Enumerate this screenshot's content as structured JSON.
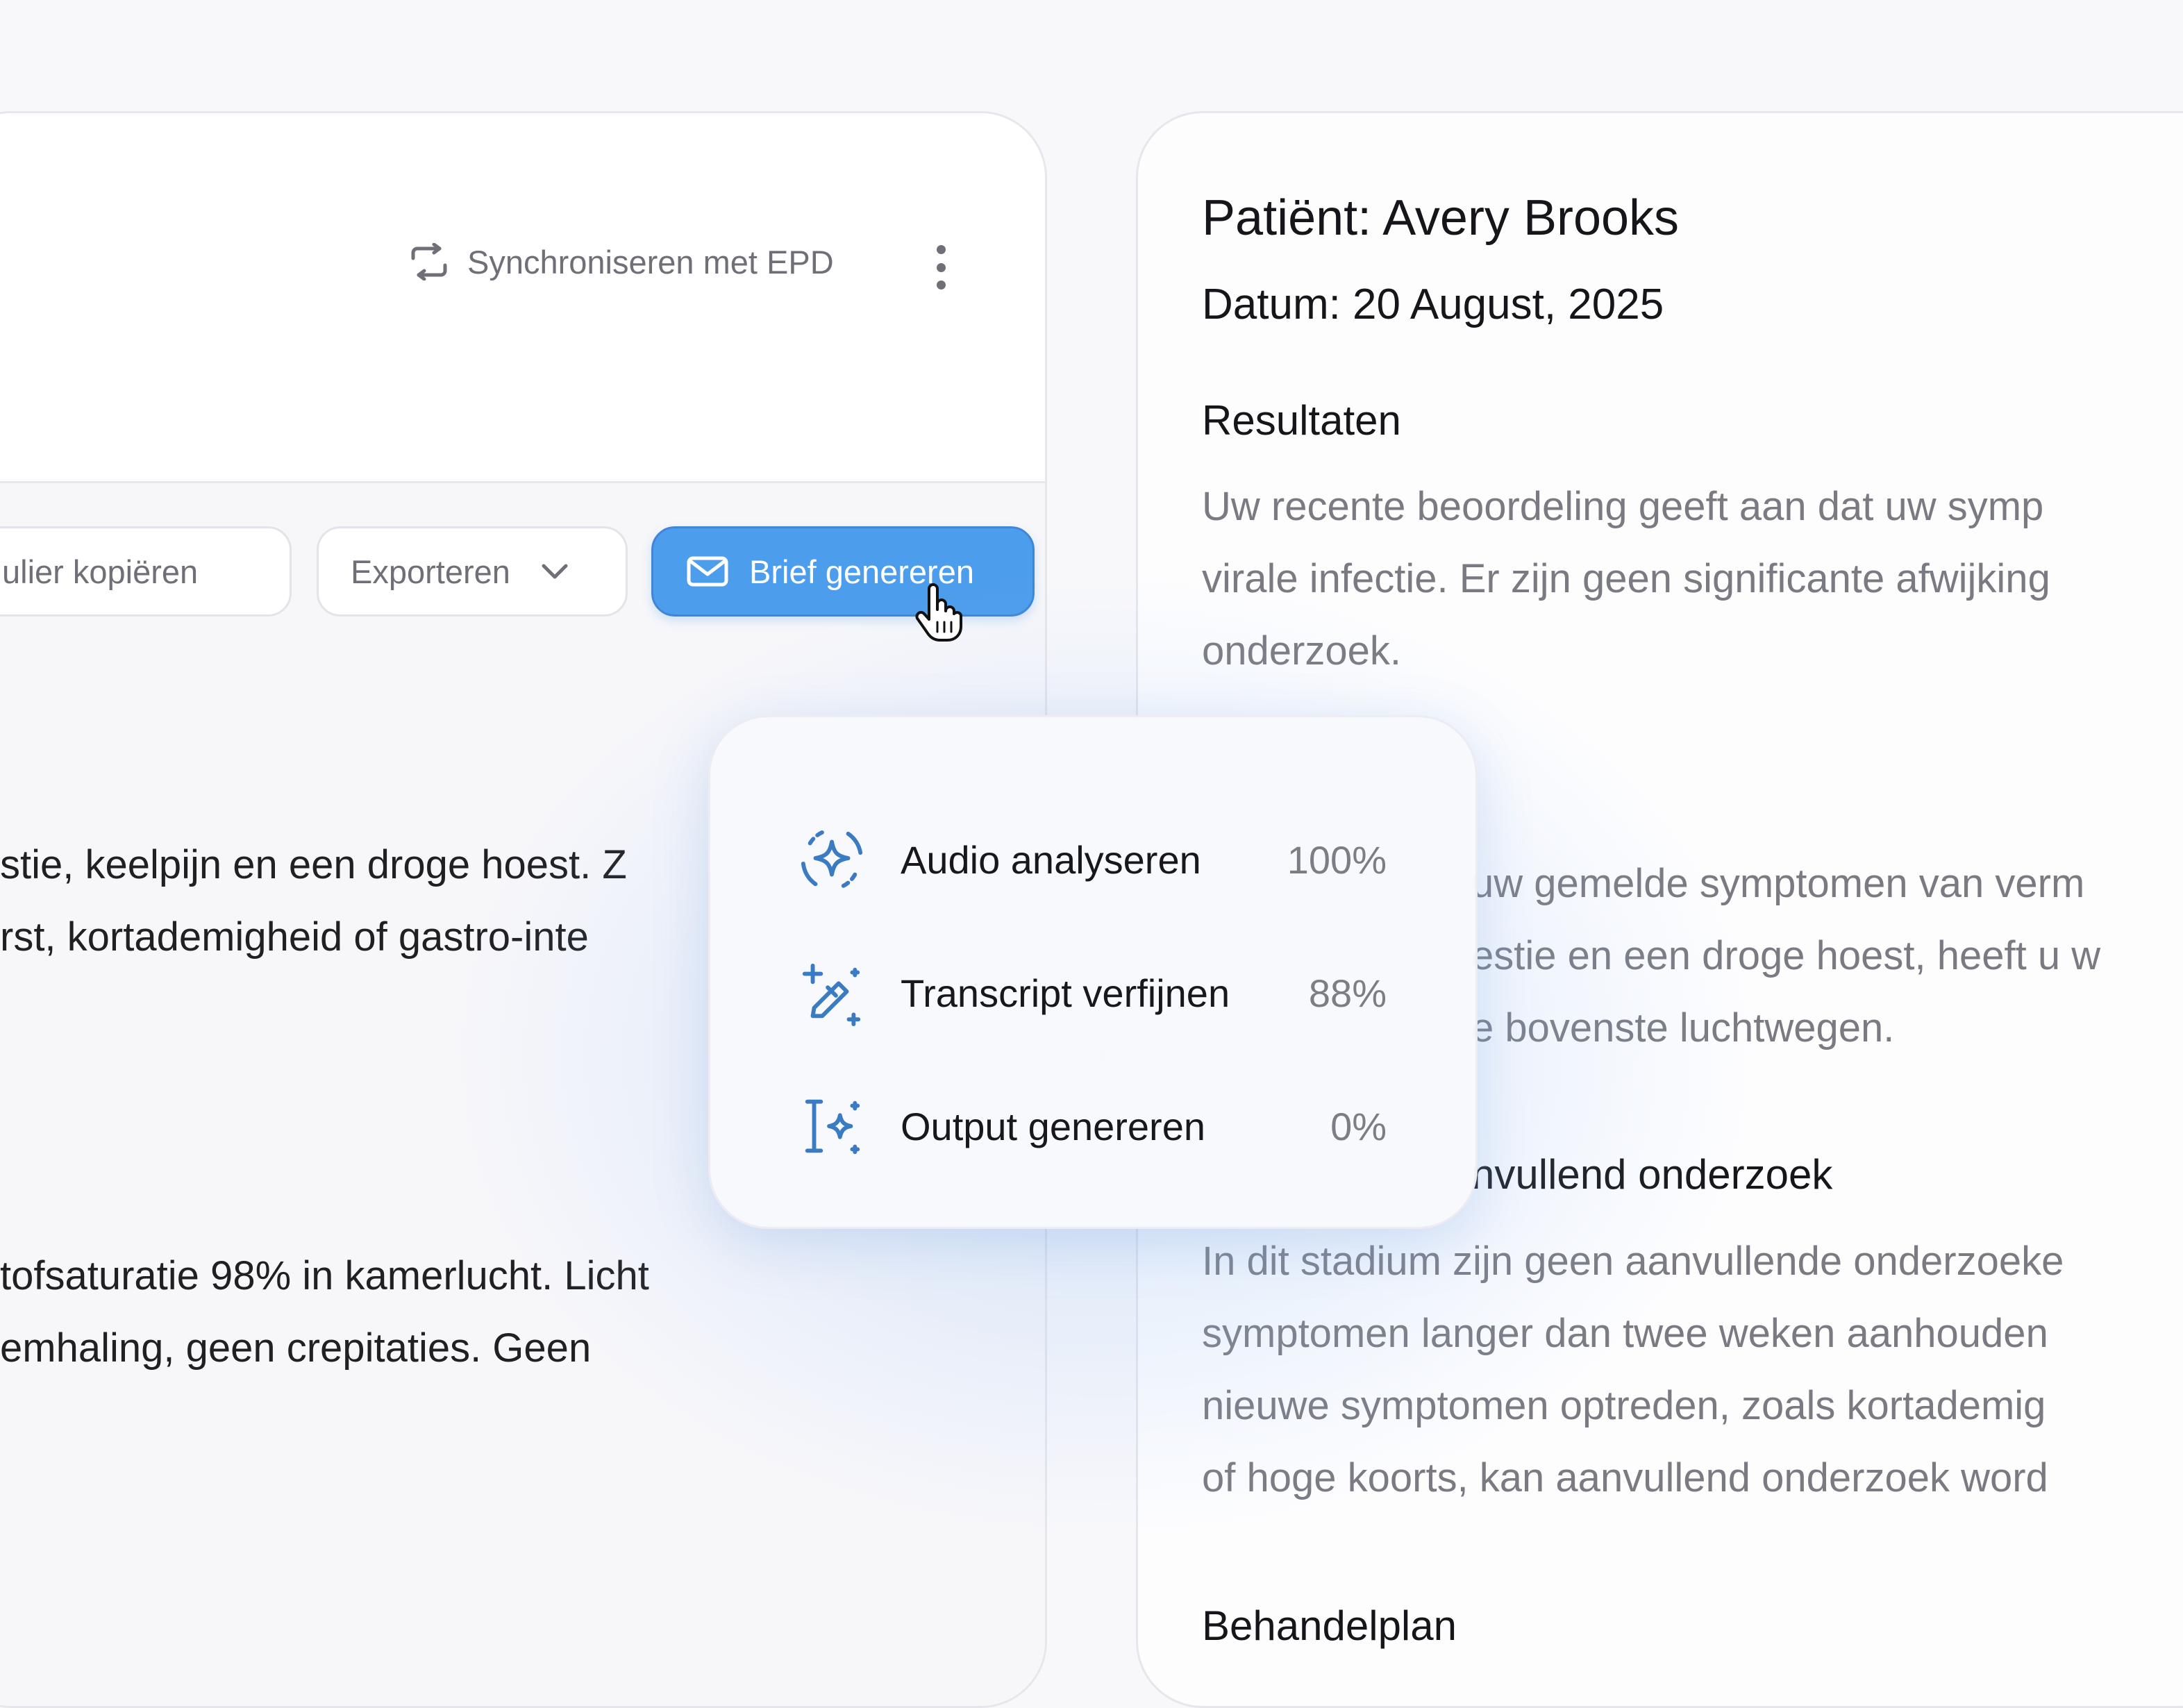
{
  "toolbar": {
    "sync_label": "Synchroniseren met EPD",
    "copy_label": "ulier kopiëren",
    "export_label": "Exporteren",
    "letter_label": "Brief genereren"
  },
  "left_note": {
    "para1": [
      "stie, keelpijn en een droge hoest. Z",
      "rst, kortademigheid of gastro-inte"
    ],
    "para2": [
      "tofsaturatie 98% in kamerlucht. Licht",
      "emhaling, geen crepitaties. Geen"
    ]
  },
  "letter": {
    "patient": "Patiënt: Avery Brooks",
    "date": "Datum: 20 August, 2025",
    "results_heading": "Resultaten",
    "results_lines": [
      "Uw recente beoordeling geeft aan dat uw symp",
      "virale infectie. Er zijn geen significante afwijking",
      "onderzoek."
    ],
    "symptoms_lines": [
      "uw gemelde symptomen van verm",
      "estie en een droge hoest, heeft u w",
      "e bovenste luchtwegen."
    ],
    "extra_heading": "nvullend onderzoek",
    "extra_lines": [
      "In dit stadium zijn geen aanvullende onderzoeke",
      "symptomen langer dan twee weken aanhouden",
      "nieuwe symptomen optreden, zoals kortademig",
      "of hoge koorts, kan aanvullend onderzoek word"
    ],
    "plan_heading": "Behandelplan"
  },
  "progress": {
    "steps": [
      {
        "label": "Audio analyseren",
        "value": "100%",
        "fraction": 1.0,
        "icon": "sparkle-icon"
      },
      {
        "label": "Transcript verfijnen",
        "value": "88%",
        "fraction": 0.88,
        "icon": "magic-wand-icon"
      },
      {
        "label": "Output genereren",
        "value": "0%",
        "fraction": 0.0,
        "icon": "text-cursor-sparkle-icon"
      }
    ]
  },
  "colors": {
    "accent": "#4d9ded",
    "icon_blue": "#3b7bc2",
    "muted_text": "#7a7a82"
  }
}
